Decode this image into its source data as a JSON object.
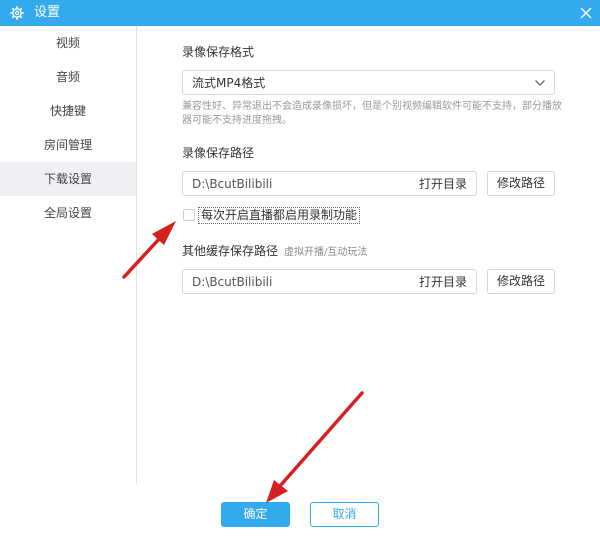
{
  "window": {
    "title": "设置",
    "accent_color": "#33aaee"
  },
  "sidebar": {
    "items": [
      {
        "label": "视频"
      },
      {
        "label": "音频"
      },
      {
        "label": "快捷键"
      },
      {
        "label": "房间管理"
      },
      {
        "label": "下载设置",
        "active": true
      },
      {
        "label": "全局设置"
      }
    ]
  },
  "record_format": {
    "title": "录像保存格式",
    "selected": "流式MP4格式",
    "hint": "兼容性好、异常退出不会造成录像损坏，但是个别视频编辑软件可能不支持，部分播放器可能不支持进度拖拽。"
  },
  "record_path": {
    "title": "录像保存路径",
    "value": "D:\\BcutBilibili",
    "open_label": "打开目录",
    "change_label": "修改路径"
  },
  "auto_record": {
    "label": "每次开启直播都启用录制功能",
    "checked": false
  },
  "cache_path": {
    "title": "其他缓存保存路径",
    "subtitle": "虚拟开播/互动玩法",
    "value": "D:\\BcutBilibili",
    "open_label": "打开目录",
    "change_label": "修改路径"
  },
  "footer": {
    "ok_label": "确定",
    "cancel_label": "取消"
  },
  "icons": {
    "title": "gear-icon",
    "close": "close-icon",
    "dropdown": "chevron-down-icon"
  },
  "annotation_color": "#d42020"
}
